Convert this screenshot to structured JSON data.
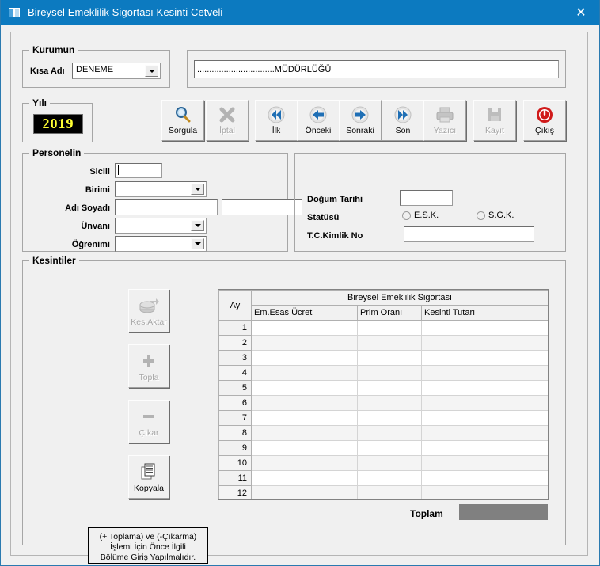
{
  "window": {
    "title": "Bireysel Emeklilik Sigortası Kesinti Cetveli",
    "close_label": "✕",
    "titlebar_color": "#0c7ac0"
  },
  "kurumun": {
    "legend": "Kurumun",
    "kisa_adi_label": "Kısa Adı",
    "kisa_adi_value": "DENEME",
    "kurum_adi_value": "................................MÜDÜRLÜĞÜ"
  },
  "yili": {
    "legend": "Yılı",
    "value": "2019",
    "fg_color": "#ffff33",
    "bg_color": "#000000"
  },
  "toolbar": {
    "buttons": [
      {
        "label": "Sorgula",
        "icon": "search-icon",
        "enabled": true
      },
      {
        "label": "İptal",
        "icon": "cancel-x-icon",
        "enabled": false
      },
      {
        "label": "İlk",
        "icon": "first-double-left-icon",
        "enabled": true
      },
      {
        "label": "Önceki",
        "icon": "previous-left-icon",
        "enabled": true
      },
      {
        "label": "Sonraki",
        "icon": "next-right-icon",
        "enabled": true
      },
      {
        "label": "Son",
        "icon": "last-double-right-icon",
        "enabled": true
      },
      {
        "label": "Yazıcı",
        "icon": "printer-icon",
        "enabled": false
      },
      {
        "label": "Kayıt",
        "icon": "save-icon",
        "enabled": false
      },
      {
        "label": "Çıkış",
        "icon": "power-exit-icon",
        "enabled": true
      }
    ]
  },
  "personelin": {
    "legend": "Personelin",
    "fields": {
      "sicili_label": "Sicili",
      "sicili_value": "",
      "birimi_label": "Birimi",
      "birimi_value": "",
      "adi_soyadi_label": "Adı Soyadı",
      "adi_value": "",
      "soyadi_value": "",
      "unvani_label": "Ünvanı",
      "unvani_value": "",
      "ogrenimi_label": "Öğrenimi",
      "ogrenimi_value": ""
    }
  },
  "personel_detay": {
    "dogum_tarihi_label": "Doğum Tarihi",
    "dogum_tarihi_value": "",
    "statusu_label": "Statüsü",
    "statusu_options": [
      "E.S.K.",
      "S.G.K."
    ],
    "statusu_selected": "",
    "tc_kimlik_label": "T.C.Kimlik No",
    "tc_kimlik_value": ""
  },
  "kesintiler": {
    "legend": "Kesintiler",
    "side_buttons": [
      {
        "label": "Kes.Aktar",
        "icon": "transfer-icon",
        "enabled": false
      },
      {
        "label": "Topla",
        "icon": "plus-icon",
        "enabled": false
      },
      {
        "label": "Çıkar",
        "icon": "minus-icon",
        "enabled": false
      },
      {
        "label": "Kopyala",
        "icon": "copy-icon",
        "enabled": true
      }
    ],
    "grid": {
      "row_header": "Ay",
      "group_header": "Bireysel Emeklilik Sigortası",
      "columns": [
        "Em.Esas Ücret",
        "Prim Oranı",
        "Kesinti Tutarı"
      ],
      "rows": [
        {
          "ay": "1",
          "em_esas_ucret": "",
          "prim_orani": "",
          "kesinti_tutari": ""
        },
        {
          "ay": "2",
          "em_esas_ucret": "",
          "prim_orani": "",
          "kesinti_tutari": ""
        },
        {
          "ay": "3",
          "em_esas_ucret": "",
          "prim_orani": "",
          "kesinti_tutari": ""
        },
        {
          "ay": "4",
          "em_esas_ucret": "",
          "prim_orani": "",
          "kesinti_tutari": ""
        },
        {
          "ay": "5",
          "em_esas_ucret": "",
          "prim_orani": "",
          "kesinti_tutari": ""
        },
        {
          "ay": "6",
          "em_esas_ucret": "",
          "prim_orani": "",
          "kesinti_tutari": ""
        },
        {
          "ay": "7",
          "em_esas_ucret": "",
          "prim_orani": "",
          "kesinti_tutari": ""
        },
        {
          "ay": "8",
          "em_esas_ucret": "",
          "prim_orani": "",
          "kesinti_tutari": ""
        },
        {
          "ay": "9",
          "em_esas_ucret": "",
          "prim_orani": "",
          "kesinti_tutari": ""
        },
        {
          "ay": "10",
          "em_esas_ucret": "",
          "prim_orani": "",
          "kesinti_tutari": ""
        },
        {
          "ay": "11",
          "em_esas_ucret": "",
          "prim_orani": "",
          "kesinti_tutari": ""
        },
        {
          "ay": "12",
          "em_esas_ucret": "",
          "prim_orani": "",
          "kesinti_tutari": ""
        }
      ]
    },
    "toplam_label": "Toplam",
    "toplam_value": "",
    "note_line1": "(+ Toplama) ve (-Çıkarma)",
    "note_line2": "İşlemi İçin Önce İlgili",
    "note_line3": "Bölüme Giriş Yapılmalıdır."
  }
}
